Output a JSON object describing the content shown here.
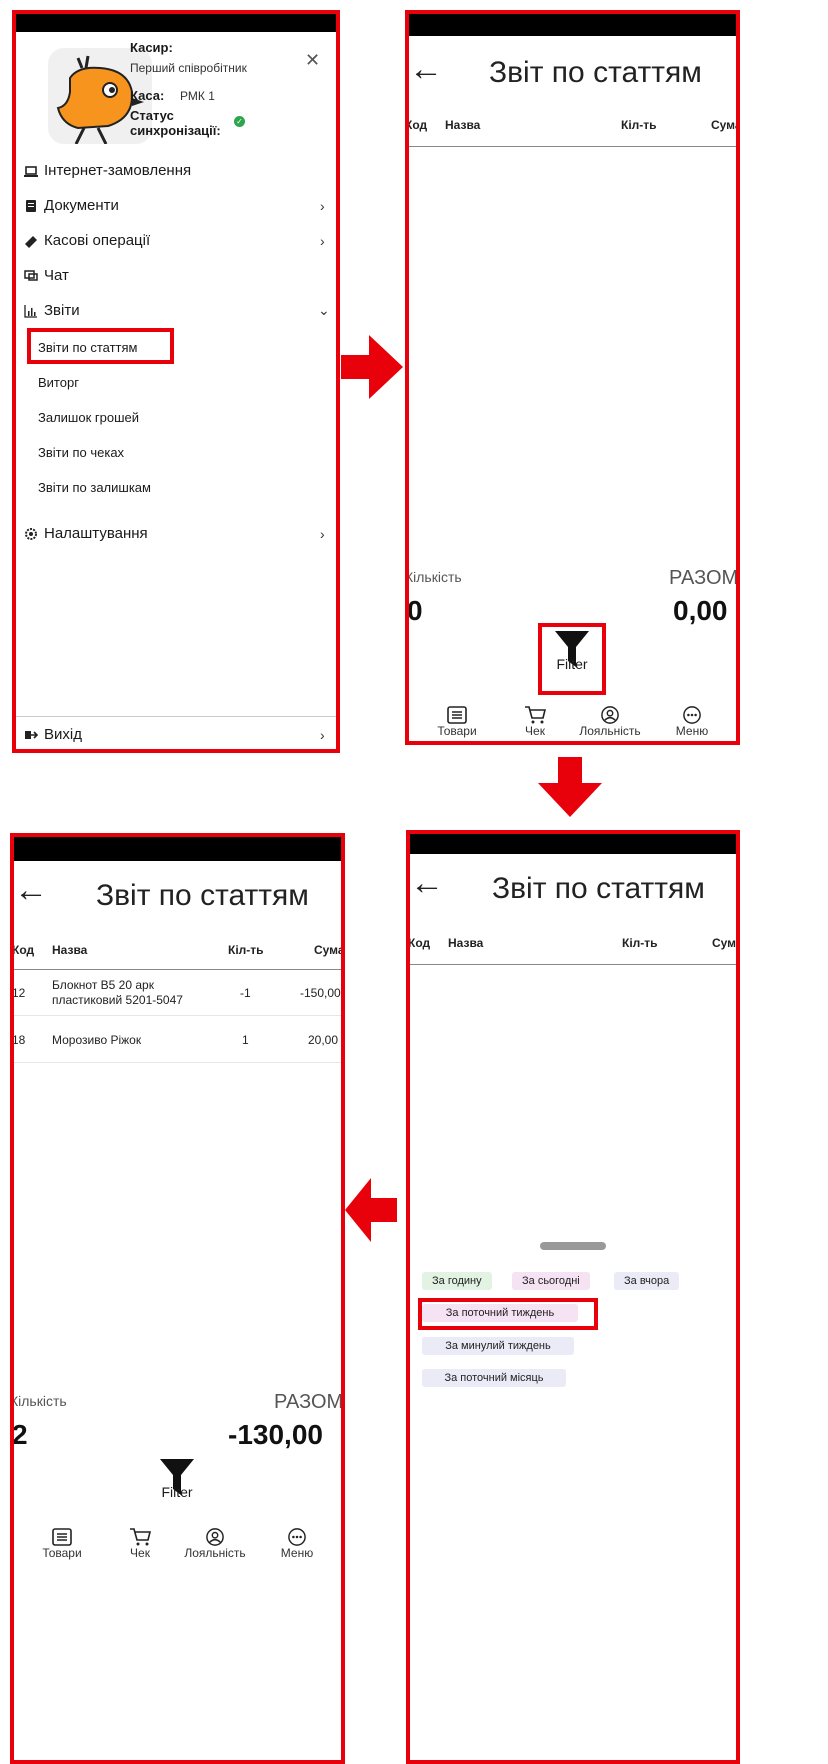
{
  "colors": {
    "highlight": "#e8000b",
    "success": "#2ea44f",
    "avatar": "#f6941d"
  },
  "menu": {
    "cashier_label": "Касир:",
    "cashier_name": "Перший співробітник",
    "till_label": "Каса:",
    "till_value": "РМК 1",
    "sync_label_1": "Статус",
    "sync_label_2": "синхронізації:",
    "items": {
      "internet": "Інтернет-замовлення",
      "documents": "Документи",
      "cash_ops": "Касові операції",
      "chat": "Чат",
      "reports": "Звіти",
      "settings": "Налаштування",
      "exit": "Вихід"
    },
    "sub_items": [
      "Звіти по статтям",
      "Виторг",
      "Залишок грошей",
      "Звіти по чеках",
      "Звіти по залишкам"
    ]
  },
  "report": {
    "title": "Звіт по статтям",
    "columns": [
      "Код",
      "Назва",
      "Кіл-ть",
      "Сума"
    ],
    "qty_label": "Кількість",
    "total_label": "РАЗОМ",
    "empty_qty": "0",
    "empty_total": "0,00",
    "filled_qty": "2",
    "filled_total": "-130,00",
    "filter_label": "Filter",
    "nav": [
      "Товари",
      "Чек",
      "Лояльність",
      "Меню"
    ],
    "rows": [
      {
        "code": "12",
        "name_1": "Блокнот В5 20 арк",
        "name_2": "пластиковий 5201-5047",
        "qty": "-1",
        "sum": "-150,00"
      },
      {
        "code": "18",
        "name_1": "Морозиво Ріжок",
        "name_2": "",
        "qty": "1",
        "sum": "20,00"
      }
    ]
  },
  "filters": [
    "За годину",
    "За сьогодні",
    "За вчора",
    "За поточний тиждень",
    "За минулий тиждень",
    "За поточний місяць"
  ]
}
